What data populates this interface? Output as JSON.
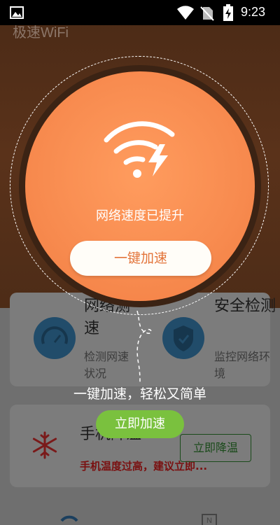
{
  "status_bar": {
    "time": "9:23"
  },
  "app": {
    "title": "极速WiFi"
  },
  "features": [
    {
      "title": "网络测速",
      "desc": "检测网速状况",
      "icon": "speedometer-icon"
    },
    {
      "title": "安全检测",
      "desc": "监控网络环境",
      "icon": "shield-check-icon"
    }
  ],
  "temperature": {
    "title": "手机降温",
    "warning": "手机温度过高，建议立即...",
    "button_label": "立即降温",
    "icon": "snowflake-icon"
  },
  "guide": {
    "status_text": "网络速度已提升",
    "accelerate_button": "一键加速",
    "hint_text": "一键加速，轻松又简单",
    "accelerate_now_button": "立即加速",
    "icon": "wifi-lightning-icon"
  },
  "colors": {
    "orange": "#F88C50",
    "green_button": "#7AC13E",
    "warning_red": "#7A1010"
  }
}
